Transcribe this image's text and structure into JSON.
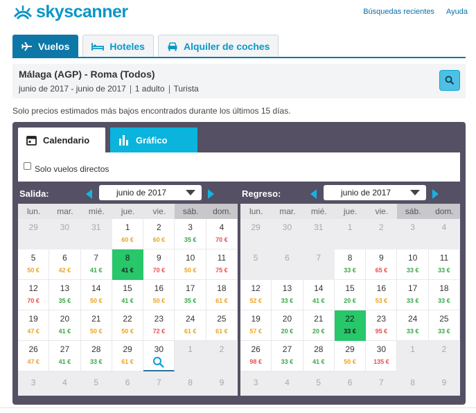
{
  "brand": {
    "name": "skyscanner",
    "color": "#0a96c8"
  },
  "toplinks": {
    "recent": "Búsquedas recientes",
    "help": "Ayuda"
  },
  "tabs": [
    {
      "label": "Vuelos",
      "icon": "plane-icon",
      "active": true
    },
    {
      "label": "Hoteles",
      "icon": "bed-icon",
      "active": false
    },
    {
      "label": "Alquiler de coches",
      "icon": "car-icon",
      "active": false
    }
  ],
  "summary": {
    "route": "Málaga (AGP) - Roma (Todos)",
    "dates": "junio de 2017 - junio de 2017",
    "passengers": "1 adulto",
    "cabin": "Turista"
  },
  "note": "Solo precios estimados más bajos encontrados durante los últimos 15 días.",
  "views": {
    "calendar": "Calendario",
    "chart": "Gráfico"
  },
  "filter": {
    "direct_only": "Solo vuelos directos",
    "checked": false
  },
  "weekdays": [
    "lun.",
    "mar.",
    "mié.",
    "jue.",
    "vie.",
    "sáb.",
    "dom."
  ],
  "departure": {
    "title": "Salida:",
    "month": "junio de 2017",
    "weeks": [
      [
        [
          "29",
          "",
          ""
        ],
        [
          "30",
          "",
          ""
        ],
        [
          "31",
          "",
          ""
        ],
        [
          "1",
          "60 €",
          "o"
        ],
        [
          "2",
          "60 €",
          "o"
        ],
        [
          "3",
          "35 €",
          "g"
        ],
        [
          "4",
          "70 €",
          "r"
        ]
      ],
      [
        [
          "5",
          "50 €",
          "o"
        ],
        [
          "6",
          "42 €",
          "o"
        ],
        [
          "7",
          "41 €",
          "g"
        ],
        [
          "8",
          "41 €",
          "sel"
        ],
        [
          "9",
          "70 €",
          "r"
        ],
        [
          "10",
          "50 €",
          "o"
        ],
        [
          "11",
          "75 €",
          "r"
        ]
      ],
      [
        [
          "12",
          "70 €",
          "r"
        ],
        [
          "13",
          "35 €",
          "g"
        ],
        [
          "14",
          "50 €",
          "o"
        ],
        [
          "15",
          "41 €",
          "g"
        ],
        [
          "16",
          "50 €",
          "o"
        ],
        [
          "17",
          "35 €",
          "g"
        ],
        [
          "18",
          "61 €",
          "o"
        ]
      ],
      [
        [
          "19",
          "47 €",
          "o"
        ],
        [
          "20",
          "41 €",
          "g"
        ],
        [
          "21",
          "50 €",
          "o"
        ],
        [
          "22",
          "50 €",
          "o"
        ],
        [
          "23",
          "72 €",
          "r"
        ],
        [
          "24",
          "61 €",
          "o"
        ],
        [
          "25",
          "61 €",
          "o"
        ]
      ],
      [
        [
          "26",
          "47 €",
          "o"
        ],
        [
          "27",
          "41 €",
          "g"
        ],
        [
          "28",
          "33 €",
          "g"
        ],
        [
          "29",
          "61 €",
          "o"
        ],
        [
          "30",
          "search",
          ""
        ],
        [
          "1",
          "",
          ""
        ],
        [
          "2",
          "",
          ""
        ]
      ],
      [
        [
          "3",
          "",
          ""
        ],
        [
          "4",
          "",
          ""
        ],
        [
          "5",
          "",
          ""
        ],
        [
          "6",
          "",
          ""
        ],
        [
          "7",
          "",
          ""
        ],
        [
          "8",
          "",
          ""
        ],
        [
          "9",
          "",
          ""
        ]
      ]
    ]
  },
  "return": {
    "title": "Regreso:",
    "month": "junio de 2017",
    "weeks": [
      [
        [
          "29",
          "",
          ""
        ],
        [
          "30",
          "",
          ""
        ],
        [
          "31",
          "",
          ""
        ],
        [
          "1",
          "",
          ""
        ],
        [
          "2",
          "",
          ""
        ],
        [
          "3",
          "",
          ""
        ],
        [
          "4",
          "",
          ""
        ]
      ],
      [
        [
          "5",
          "",
          ""
        ],
        [
          "6",
          "",
          ""
        ],
        [
          "7",
          "",
          ""
        ],
        [
          "8",
          "33 €",
          "g"
        ],
        [
          "9",
          "65 €",
          "r"
        ],
        [
          "10",
          "33 €",
          "g"
        ],
        [
          "11",
          "33 €",
          "g"
        ]
      ],
      [
        [
          "12",
          "52 €",
          "o"
        ],
        [
          "13",
          "33 €",
          "g"
        ],
        [
          "14",
          "41 €",
          "g"
        ],
        [
          "15",
          "20 €",
          "g"
        ],
        [
          "16",
          "53 €",
          "o"
        ],
        [
          "17",
          "33 €",
          "g"
        ],
        [
          "18",
          "33 €",
          "g"
        ]
      ],
      [
        [
          "19",
          "57 €",
          "o"
        ],
        [
          "20",
          "20 €",
          "g"
        ],
        [
          "21",
          "20 €",
          "g"
        ],
        [
          "22",
          "33 €",
          "sel"
        ],
        [
          "23",
          "95 €",
          "r"
        ],
        [
          "24",
          "33 €",
          "g"
        ],
        [
          "25",
          "33 €",
          "g"
        ]
      ],
      [
        [
          "26",
          "98 €",
          "r"
        ],
        [
          "27",
          "33 €",
          "g"
        ],
        [
          "28",
          "41 €",
          "g"
        ],
        [
          "29",
          "50 €",
          "o"
        ],
        [
          "30",
          "135 €",
          "r"
        ],
        [
          "1",
          "",
          ""
        ],
        [
          "2",
          "",
          ""
        ]
      ],
      [
        [
          "3",
          "",
          ""
        ],
        [
          "4",
          "",
          ""
        ],
        [
          "5",
          "",
          ""
        ],
        [
          "6",
          "",
          ""
        ],
        [
          "7",
          "",
          ""
        ],
        [
          "8",
          "",
          ""
        ],
        [
          "9",
          "",
          ""
        ]
      ]
    ]
  }
}
